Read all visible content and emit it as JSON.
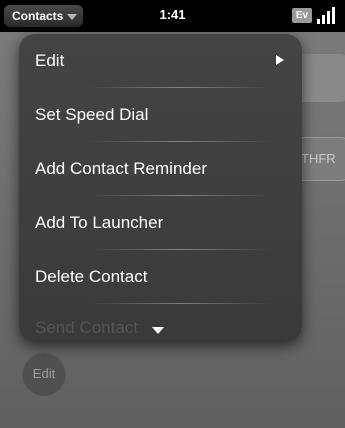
{
  "status_bar": {
    "app_menu_label": "Contacts",
    "clock": "1:41",
    "network_badge": "Ev"
  },
  "background": {
    "pill_text": "THFR",
    "edit_button_label": "Edit"
  },
  "menu": {
    "items": [
      {
        "label": "Edit",
        "has_submenu": true
      },
      {
        "label": "Set Speed Dial"
      },
      {
        "label": "Add Contact Reminder"
      },
      {
        "label": "Add To Launcher"
      },
      {
        "label": "Delete Contact"
      }
    ],
    "faded_item_label": "Send Contact"
  }
}
